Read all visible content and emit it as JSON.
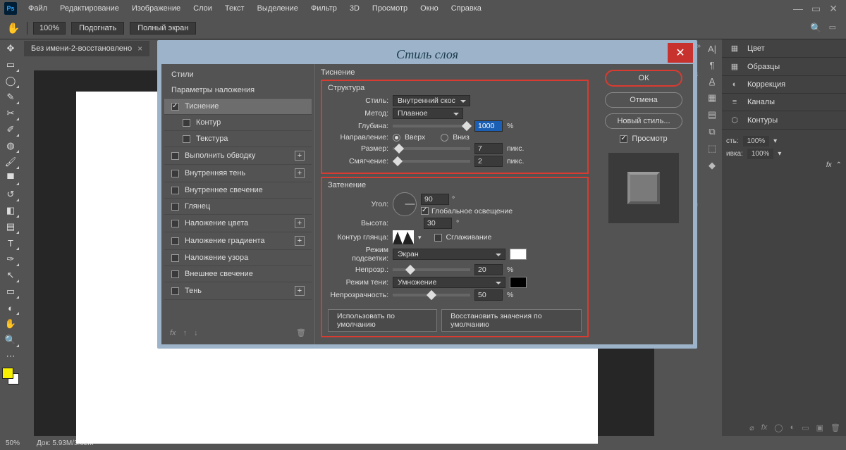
{
  "menu": {
    "items": [
      "Файл",
      "Редактирование",
      "Изображение",
      "Слои",
      "Текст",
      "Выделение",
      "Фильтр",
      "3D",
      "Просмотр",
      "Окно",
      "Справка"
    ]
  },
  "options": {
    "zoom": "100%",
    "fit": "Подогнать",
    "fullscreen": "Полный экран"
  },
  "document": {
    "tab": "Без имени-2-восстановлено"
  },
  "dialog": {
    "title": "Стиль слоя",
    "leftHeader": "Стили",
    "blending": "Параметры наложения",
    "effects": {
      "emboss": "Тиснение",
      "contour": "Контур",
      "texture": "Текстура",
      "stroke": "Выполнить обводку",
      "innerShadow": "Внутренняя тень",
      "innerGlow": "Внутреннее свечение",
      "satin": "Глянец",
      "colorOverlay": "Наложение цвета",
      "gradOverlay": "Наложение градиента",
      "patternOverlay": "Наложение узора",
      "outerGlow": "Внешнее свечение",
      "dropShadow": "Тень"
    },
    "sectionTitle": "Тиснение",
    "structure": {
      "header": "Структура",
      "styleLabel": "Стиль:",
      "styleValue": "Внутренний скос",
      "methodLabel": "Метод:",
      "methodValue": "Плавное",
      "depthLabel": "Глубина:",
      "depthValue": "1000",
      "depthUnit": "%",
      "directionLabel": "Направление:",
      "dirUp": "Вверх",
      "dirDown": "Вниз",
      "sizeLabel": "Размер:",
      "sizeValue": "7",
      "sizeUnit": "пикс.",
      "softenLabel": "Смягчение:",
      "softenValue": "2",
      "softenUnit": "пикс."
    },
    "shading": {
      "header": "Затенение",
      "angleLabel": "Угол:",
      "angleValue": "90",
      "deg": "°",
      "globalLight": "Глобальное освещение",
      "altitudeLabel": "Высота:",
      "altitudeValue": "30",
      "glossLabel": "Контур глянца:",
      "antialias": "Сглаживание",
      "hlModeLabel": "Режим подсветки:",
      "hlModeValue": "Экран",
      "hlOpacityLabel": "Непрозр.:",
      "hlOpacityValue": "20",
      "pct": "%",
      "shModeLabel": "Режим тени:",
      "shModeValue": "Умножение",
      "shOpacityLabel": "Непрозрачность:",
      "shOpacityValue": "50"
    },
    "defaults": {
      "makeDefault": "Использовать по умолчанию",
      "resetDefault": "Восстановить значения по умолчанию"
    },
    "right": {
      "ok": "ОК",
      "cancel": "Отмена",
      "newStyle": "Новый стиль...",
      "preview": "Просмотр"
    }
  },
  "rightDock": {
    "color": "Цвет",
    "swatches": "Образцы",
    "adjustments": "Коррекция",
    "channels": "Каналы",
    "paths": "Контуры",
    "opacityLabel": "100%",
    "fillLabel": "100%",
    "fillWord": "ивка:"
  },
  "status": {
    "zoom": "50%",
    "docsize": "Док: 5.93M/3.62M"
  }
}
